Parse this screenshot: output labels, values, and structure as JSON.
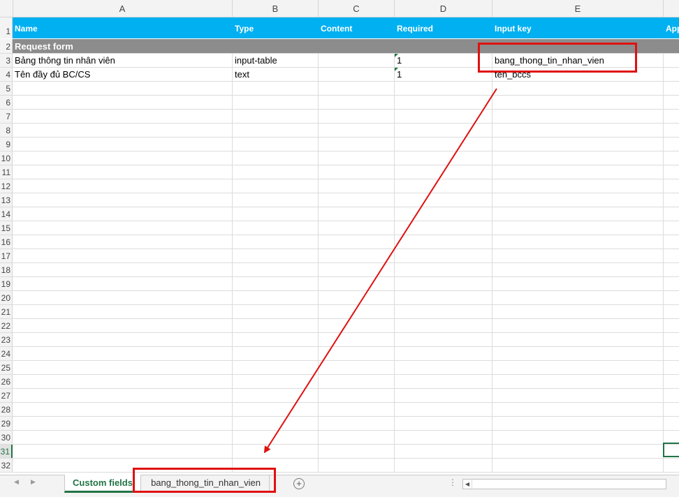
{
  "columns": [
    "A",
    "B",
    "C",
    "D",
    "E",
    ""
  ],
  "row_numbers": [
    "1",
    "2",
    "3",
    "4",
    "5",
    "6",
    "7",
    "8",
    "9",
    "10",
    "11",
    "12",
    "13",
    "14",
    "15",
    "16",
    "17",
    "18",
    "19",
    "20",
    "21",
    "22",
    "23",
    "24",
    "25",
    "26",
    "27",
    "28",
    "29",
    "30",
    "31",
    "32"
  ],
  "header_row": {
    "name": "Name",
    "type": "Type",
    "content": "Content",
    "required": "Required",
    "input_key": "Input key",
    "extra": "App"
  },
  "section_row": {
    "label": "Request form"
  },
  "data_rows": [
    {
      "name": "Bảng thông tin nhân viên",
      "type": "input-table",
      "content": "",
      "required": "1",
      "input_key": "bang_thong_tin_nhan_vien"
    },
    {
      "name": "Tên đầy đủ BC/CS",
      "type": "text",
      "content": "",
      "required": "1",
      "input_key": "ten_bccs"
    }
  ],
  "sheet_tabs": {
    "active": "Custom fields",
    "second": "bang_thong_tin_nhan_vien",
    "add_label": "+"
  },
  "colors": {
    "header_fill": "#00b0f0",
    "section_fill": "#8c8c8c",
    "accent": "#217346",
    "annotation": "#e01010"
  }
}
